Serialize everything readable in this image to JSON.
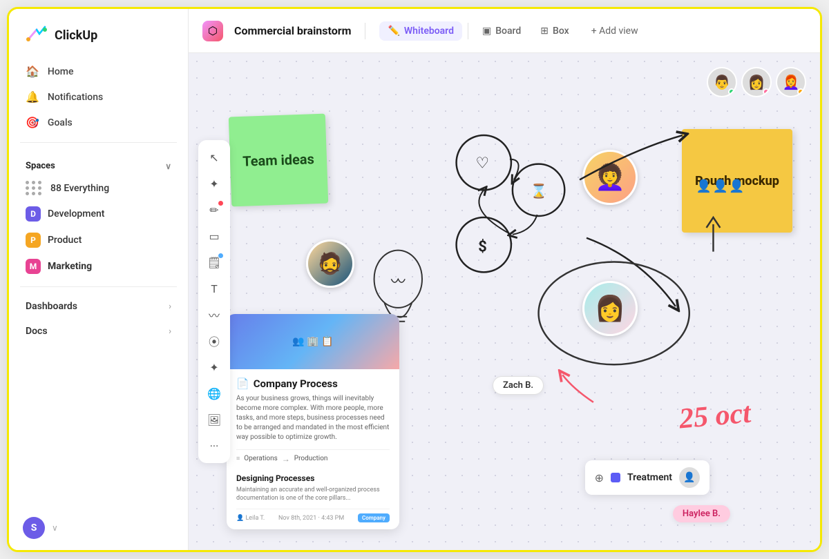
{
  "app": {
    "name": "ClickUp"
  },
  "sidebar": {
    "nav_items": [
      {
        "id": "home",
        "label": "Home",
        "icon": "🏠"
      },
      {
        "id": "notifications",
        "label": "Notifications",
        "icon": "🔔"
      },
      {
        "id": "goals",
        "label": "Goals",
        "icon": "🎯"
      }
    ],
    "spaces_label": "Spaces",
    "spaces": [
      {
        "id": "everything",
        "label": "Everything",
        "count": "88",
        "type": "grid",
        "color": "#aaa"
      },
      {
        "id": "development",
        "label": "Development",
        "type": "badge",
        "color": "#6c5ce7",
        "letter": "D"
      },
      {
        "id": "product",
        "label": "Product",
        "type": "badge",
        "color": "#f5a623",
        "letter": "P"
      },
      {
        "id": "marketing",
        "label": "Marketing",
        "type": "badge",
        "color": "#e84393",
        "letter": "M",
        "bold": true
      }
    ],
    "bottom_items": [
      {
        "id": "dashboards",
        "label": "Dashboards"
      },
      {
        "id": "docs",
        "label": "Docs"
      }
    ],
    "user": {
      "initial": "S",
      "color": "#6c5ce7"
    }
  },
  "header": {
    "project_title": "Commercial brainstorm",
    "tabs": [
      {
        "id": "whiteboard",
        "label": "Whiteboard",
        "icon": "✏️",
        "active": true
      },
      {
        "id": "board",
        "label": "Board",
        "icon": "⬛"
      },
      {
        "id": "box",
        "label": "Box",
        "icon": "⊞"
      }
    ],
    "add_view_label": "+ Add view"
  },
  "canvas": {
    "sticky_green_text": "Team ideas",
    "sticky_yellow_text": "Rough mockup",
    "process_card": {
      "title": "Company Process",
      "description": "As your business grows, things will inevitably become more complex. With more people, more tasks, and more steps, business processes need to be arranged and mandated in the most efficient way possible to optimize growth.",
      "row_from": "Operations",
      "row_to": "Production",
      "section_title": "Designing Processes",
      "section_desc": "Maintaining an accurate and well-organized process documentation is one of the core pillars...",
      "author": "Leila T.",
      "date": "Nov 8th, 2021 · 4:43 PM",
      "tag": "Company"
    },
    "zach_label": "Zach B.",
    "haylee_label": "Haylee B.",
    "treatment_label": "Treatment",
    "oct_date": "25 oct",
    "move_cursor": "⊕"
  },
  "icons": {
    "heart": "♡",
    "hourglass": "⌛",
    "dollar": "$",
    "cursor": "↗",
    "pen": "✏",
    "rect": "▭",
    "note": "🗒",
    "text_t": "T",
    "squiggle": "〰",
    "connector": "⦿",
    "sparkle": "✦",
    "globe": "🌐",
    "image": "🖼",
    "more": "···"
  }
}
